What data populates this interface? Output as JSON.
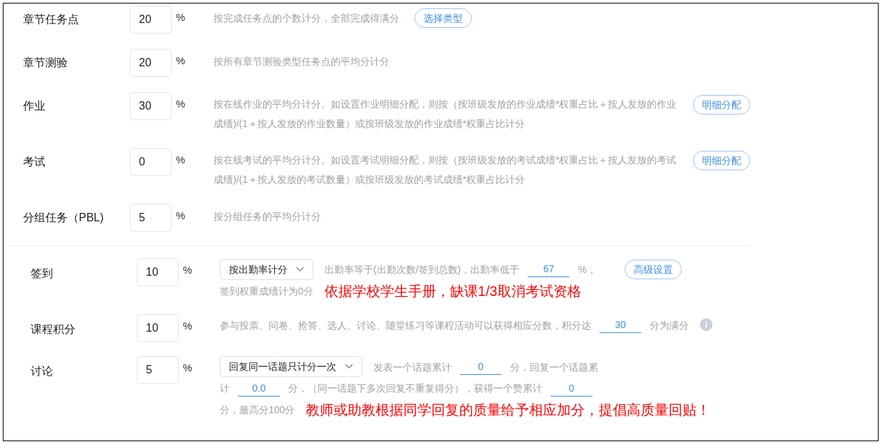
{
  "weights": [
    {
      "label": "章节任务点",
      "value": "20",
      "unit": "%",
      "description": "按完成任务点的个数计分，全部完成得满分",
      "button": "选择类型",
      "kind": "inline_button"
    },
    {
      "label": "章节测验",
      "value": "20",
      "unit": "%",
      "description": "按所有章节测验类型任务点的平均分计分",
      "kind": "plain"
    },
    {
      "label": "作业",
      "value": "30",
      "unit": "%",
      "description": "按在线作业的平均分计分。如设置作业明细分配，则按（按班级发放的作业成绩*权重占比＋按人发放的作业成绩)/(1＋按人发放的作业数量）或按班级发放的作业成绩*权重占比计分",
      "button": "明细分配",
      "kind": "side_button"
    },
    {
      "label": "考试",
      "value": "0",
      "unit": "%",
      "description": "按在线考试的平均分计分。如设置考试明细分配，则按（按班级发放的考试成绩*权重占比＋按人发放的考试成绩)/(1＋按人发放的考试数量）或按班级发放的考试成绩*权重占比计分",
      "button": "明细分配",
      "kind": "side_button"
    },
    {
      "label": "分组任务（PBL)",
      "value": "5",
      "unit": "%",
      "description": "按分组任务的平均分计分",
      "kind": "plain"
    }
  ],
  "activities": [
    {
      "label": "签到",
      "value": "10",
      "unit": "%",
      "parts": [
        {
          "kind": "select",
          "text": "按出勤率计分"
        },
        {
          "kind": "text",
          "text": "出勤率等于(出勤次数/签到总数)，出勤率低于"
        },
        {
          "kind": "input",
          "value": "67"
        },
        {
          "kind": "text",
          "text": "%，"
        },
        {
          "kind": "button",
          "text": "高级设置"
        },
        {
          "kind": "break"
        },
        {
          "kind": "text",
          "text": "签到权重成绩计为0分"
        },
        {
          "kind": "note",
          "text": "依据学校学生手册，缺课1/3取消考试资格"
        }
      ]
    },
    {
      "label": "课程积分",
      "value": "10",
      "unit": "%",
      "parts": [
        {
          "kind": "text",
          "text": "参与投票、问卷、抢答、选人、讨论、随堂练习等课程活动可以获得相应分数，积分达"
        },
        {
          "kind": "input",
          "value": "30"
        },
        {
          "kind": "text",
          "text": "分为满分"
        },
        {
          "kind": "info"
        }
      ]
    },
    {
      "label": "讨论",
      "value": "5",
      "unit": "%",
      "parts": [
        {
          "kind": "select",
          "text": "回复同一话题只计分一次"
        },
        {
          "kind": "text",
          "text": "发表一个话题累计"
        },
        {
          "kind": "input",
          "value": "0"
        },
        {
          "kind": "text",
          "text": "分，回复一个话题累"
        },
        {
          "kind": "break"
        },
        {
          "kind": "text",
          "text": "计"
        },
        {
          "kind": "input",
          "value": "0.0"
        },
        {
          "kind": "text",
          "text": "分，（同一话题下多次回复不重复得分），获得一个赞累计"
        },
        {
          "kind": "input",
          "value": "0"
        },
        {
          "kind": "break"
        },
        {
          "kind": "text",
          "text": "分，最高分100分"
        },
        {
          "kind": "note",
          "text": "教师或助教根据同学回复的质量给予相应加分，提倡高质量回贴！"
        }
      ]
    }
  ]
}
